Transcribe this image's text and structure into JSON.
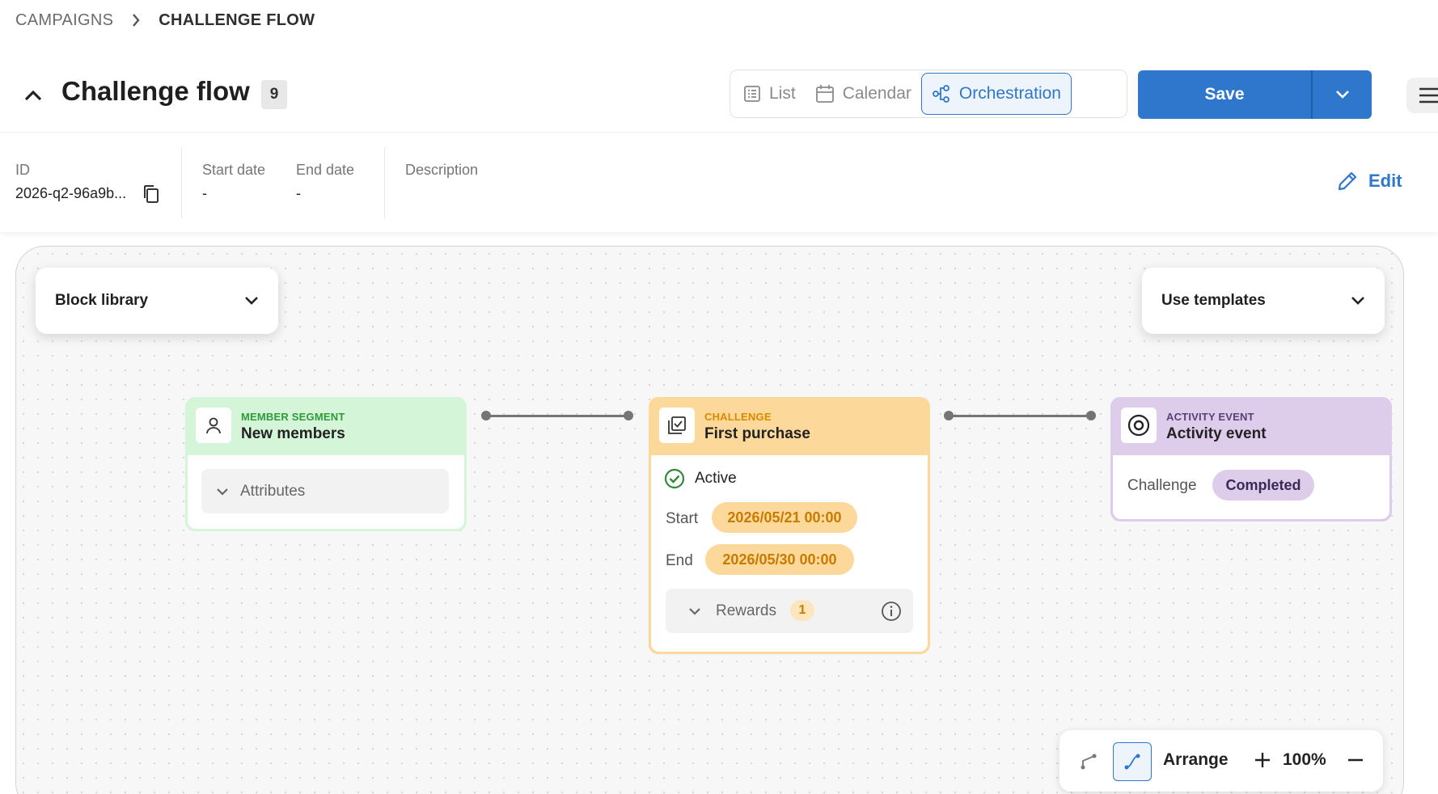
{
  "breadcrumb": {
    "parent": "CAMPAIGNS",
    "current": "CHALLENGE FLOW"
  },
  "header": {
    "title": "Challenge flow",
    "count": "9",
    "views": [
      {
        "label": "List",
        "icon": "list-icon"
      },
      {
        "label": "Calendar",
        "icon": "calendar-icon"
      },
      {
        "label": "Orchestration",
        "icon": "orchestration-icon",
        "active": true
      }
    ],
    "save_label": "Save"
  },
  "info": {
    "id_label": "ID",
    "id_value": "2026-q2-96a9b...",
    "start_label": "Start date",
    "start_value": "-",
    "end_label": "End date",
    "end_value": "-",
    "description_label": "Description",
    "edit_label": "Edit"
  },
  "canvas": {
    "block_library_label": "Block library",
    "templates_label": "Use templates",
    "nodes": {
      "segment": {
        "type": "MEMBER SEGMENT",
        "name": "New members",
        "attributes_label": "Attributes"
      },
      "challenge": {
        "type": "CHALLENGE",
        "name": "First purchase",
        "status": "Active",
        "start_label": "Start",
        "start_value": "2026/05/21 00:00",
        "end_label": "End",
        "end_value": "2026/05/30 00:00",
        "rewards_label": "Rewards",
        "rewards_count": "1"
      },
      "activity": {
        "type": "ACTIVITY EVENT",
        "name": "Activity event",
        "field_label": "Challenge",
        "field_value": "Completed"
      }
    },
    "toolbar": {
      "arrange_label": "Arrange",
      "zoom": "100%"
    }
  },
  "colors": {
    "primary": "#2f77cd",
    "segment_bg": "#d4f5d8",
    "segment_accent": "#2e9a3a",
    "challenge_bg": "#fcd89a",
    "challenge_accent": "#d98a00",
    "activity_bg": "#ddccea",
    "activity_accent": "#5a3f7a"
  }
}
